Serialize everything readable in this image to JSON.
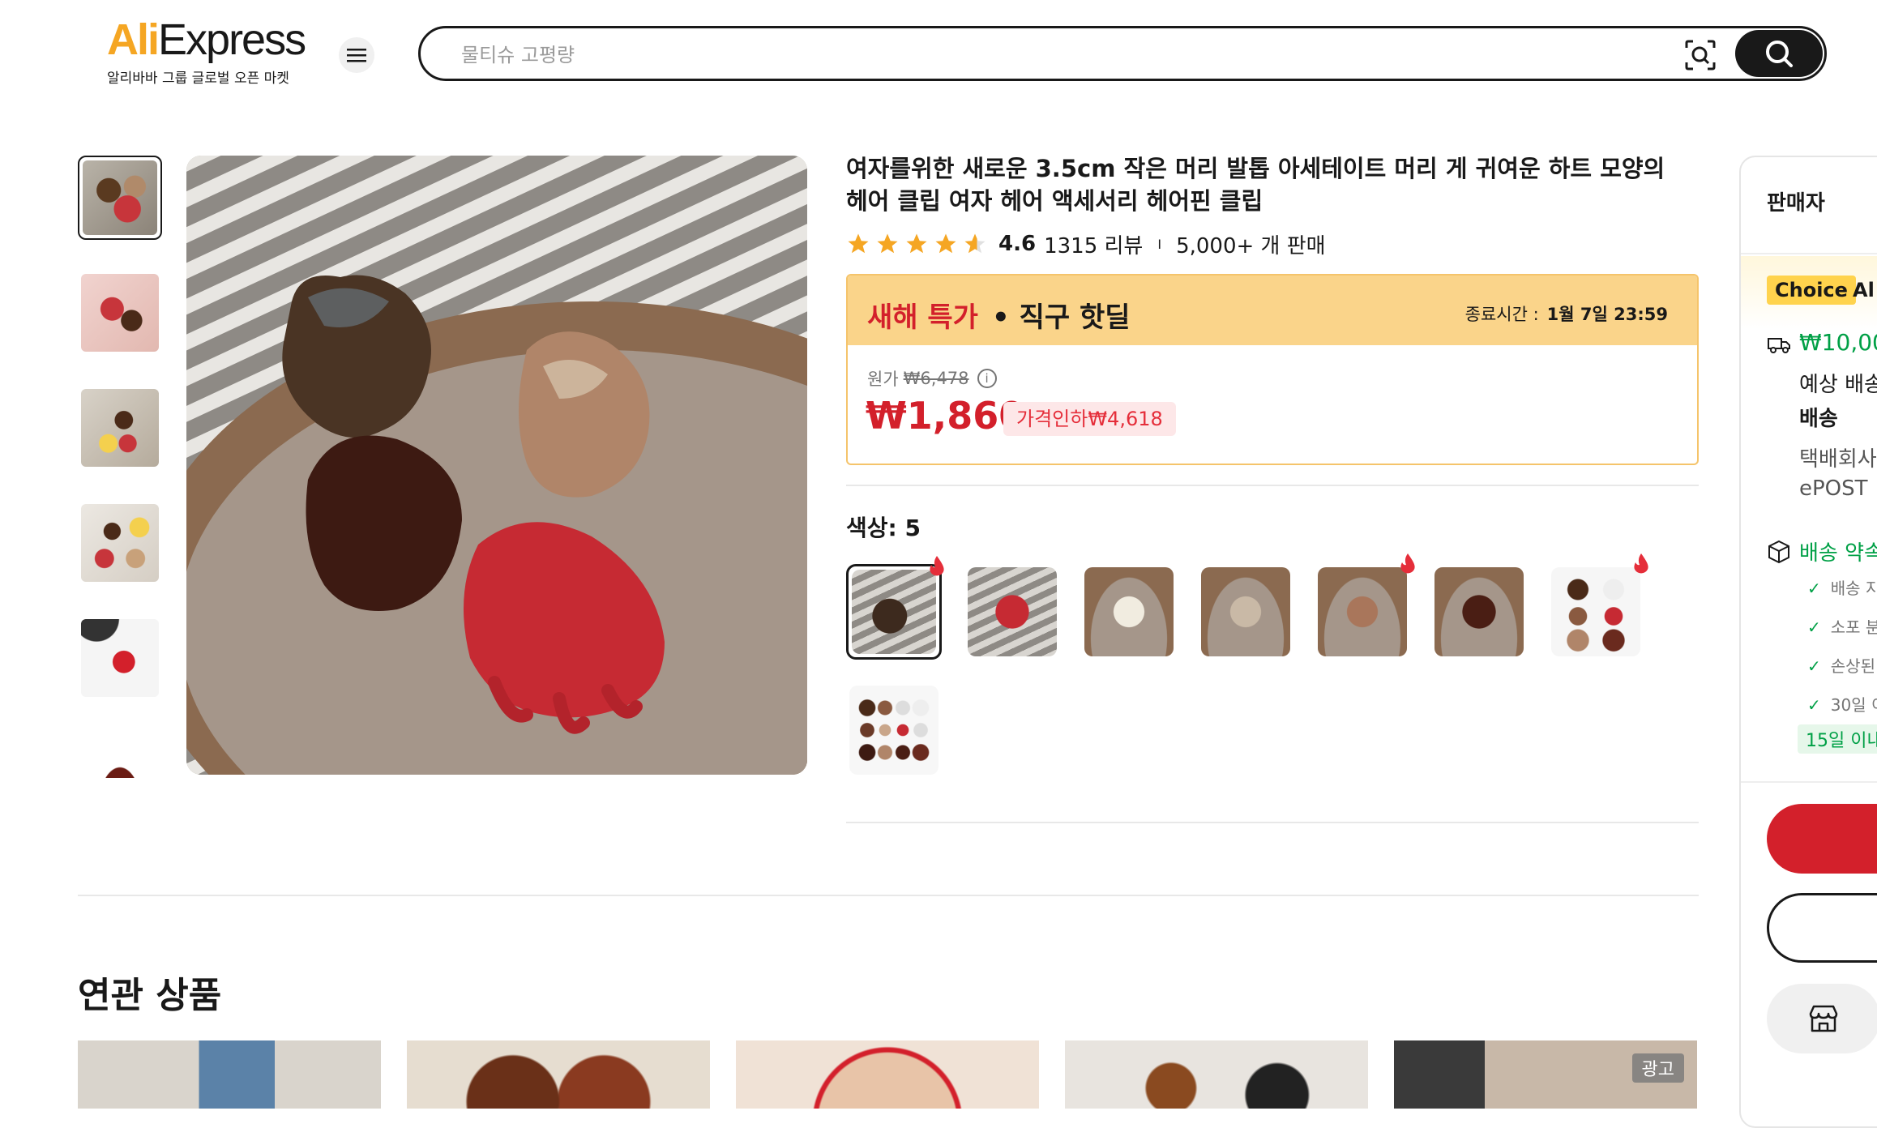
{
  "header": {
    "logo_prefix": "Ali",
    "logo_suffix": "Express",
    "logo_tagline": "알리바바 그룹 글로벌 오픈 마켓",
    "search_placeholder": "물티슈 고평량"
  },
  "product": {
    "title": "여자를위한 새로운 3.5cm 작은 머리 발톱 아세테이트 머리 게 귀여운 하트 모양의 헤어 클립 여자 헤어 액세서리 헤어핀 클립",
    "rating": "4.6",
    "reviews": "1315 리뷰",
    "separator": "I",
    "sold": "5,000+ 개 판매",
    "sale": {
      "label_red": "새해 특가",
      "label_dark": "• 직구 핫딜",
      "end_label": "종료시간 :",
      "end_time": "1월 7일 23:59",
      "original_label": "원가",
      "original_price": "₩6,478",
      "price": "₩1,860",
      "discount": "가격인하₩4,618"
    },
    "color_label": "색상: 5"
  },
  "related": {
    "title": "연관 상품",
    "ad_label": "광고"
  },
  "panel": {
    "seller": "판매자",
    "choice": "Choice",
    "choice_suffix": "Al",
    "shipping_price": "₩10,00",
    "est_label": "예상 배송",
    "delivery": "배송",
    "courier": "택배회사",
    "courier_name": "ePOST",
    "promise": "배송 약속",
    "checks": [
      "배송 지",
      "소포 분",
      "손상된",
      "30일 이"
    ],
    "days_badge": "15일 이내"
  },
  "colors": {
    "accent_red": "#d3202b",
    "banner_yellow": "#fad48a",
    "choice_green": "#00a046"
  }
}
